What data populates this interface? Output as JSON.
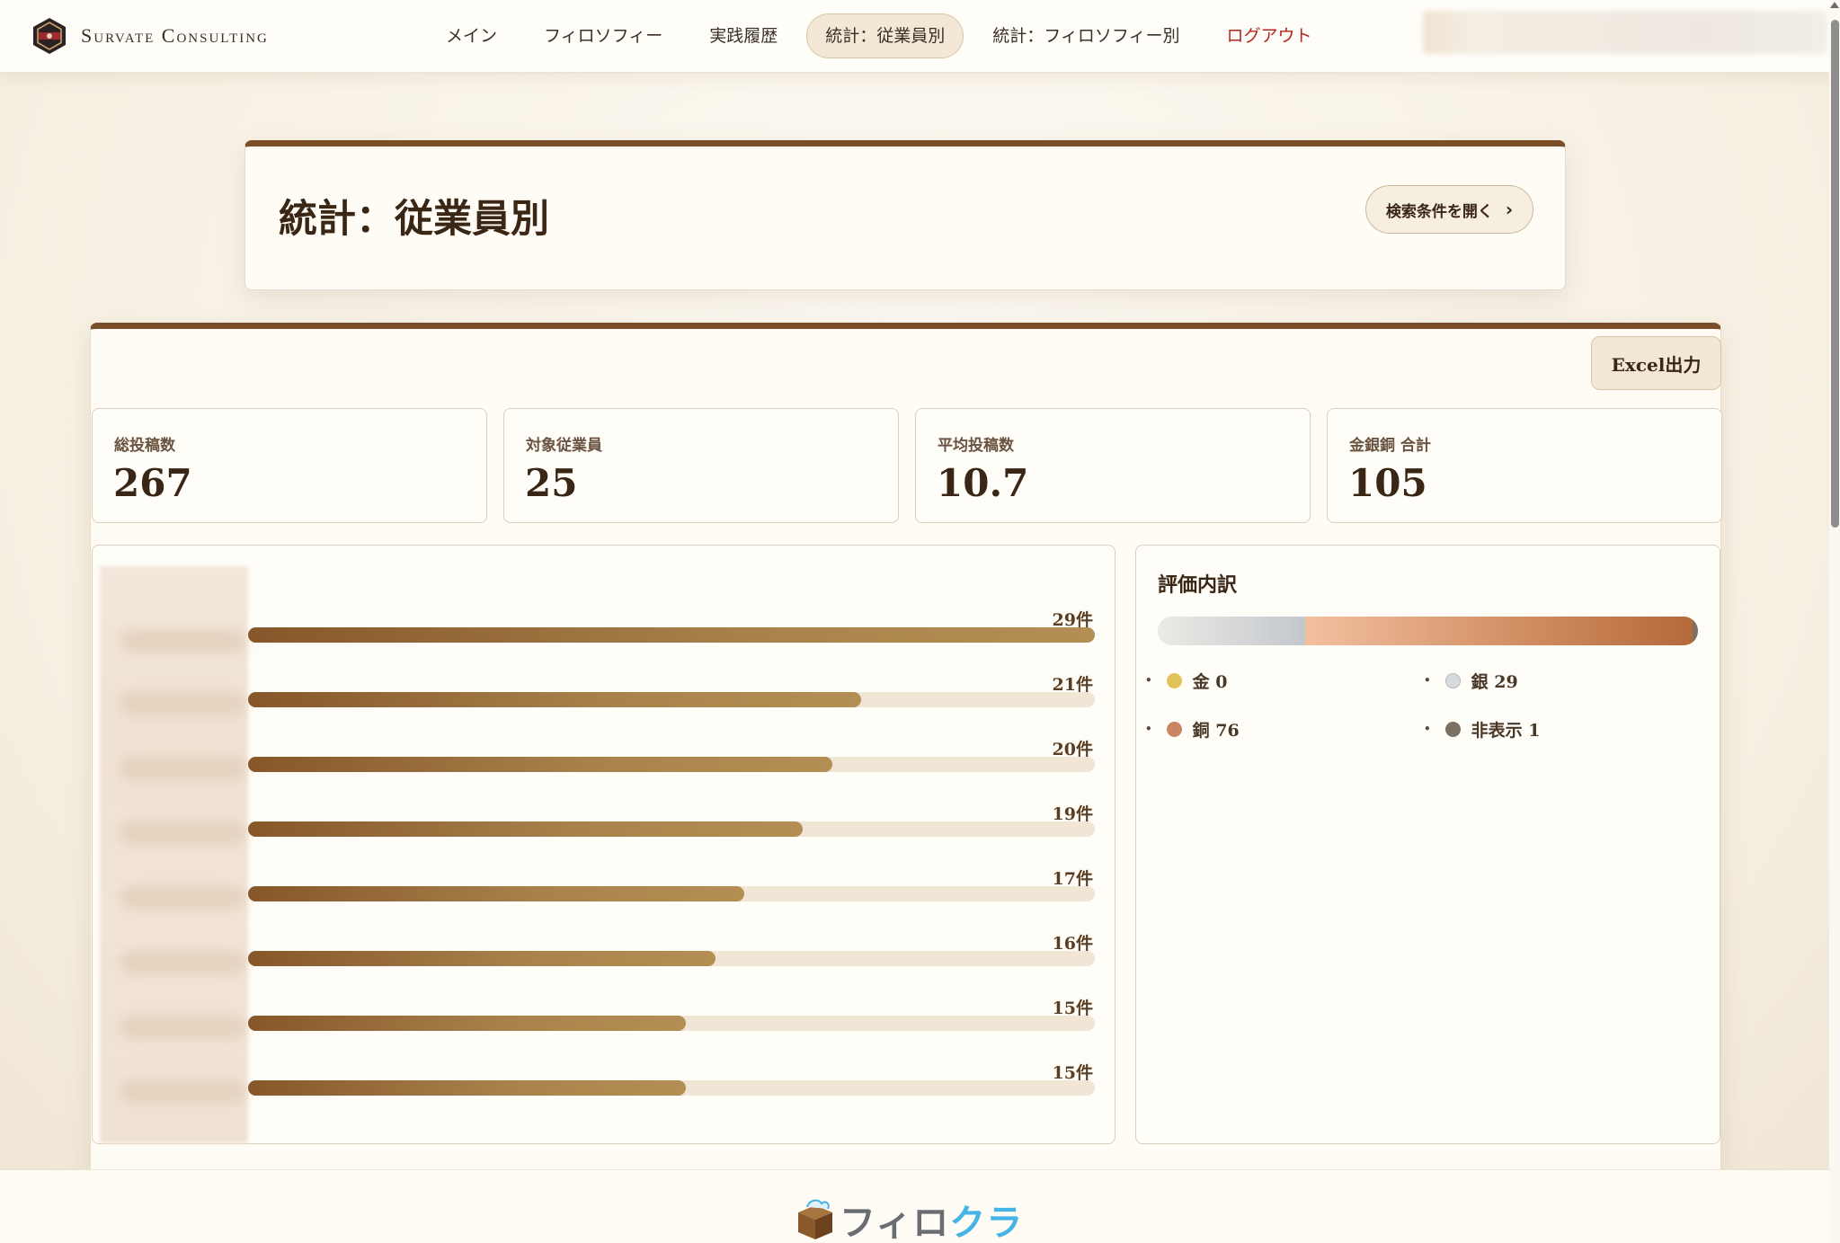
{
  "header": {
    "brand": "Survate Consulting",
    "nav": [
      {
        "label": "メイン",
        "active": false
      },
      {
        "label": "フィロソフィー",
        "active": false
      },
      {
        "label": "実践履歴",
        "active": false
      },
      {
        "label": "統計：従業員別",
        "active": true
      },
      {
        "label": "統計：フィロソフィー別",
        "active": false
      }
    ],
    "logout_label": "ログアウト"
  },
  "title_panel": {
    "title": "統計：従業員別",
    "search_toggle_label": "検索条件を開く"
  },
  "stats": {
    "excel_label": "Excel出力",
    "kpis": [
      {
        "label": "総投稿数",
        "value": "267"
      },
      {
        "label": "対象従業員",
        "value": "25"
      },
      {
        "label": "平均投稿数",
        "value": "10.7"
      },
      {
        "label": "金銀銅 合計",
        "value": "105"
      }
    ]
  },
  "chart_data": [
    {
      "type": "bar",
      "orientation": "horizontal",
      "title": "",
      "categories": [
        "",
        "",
        "",
        "",
        "",
        "",
        "",
        ""
      ],
      "values": [
        29,
        21,
        20,
        19,
        17,
        16,
        15,
        15
      ],
      "value_labels": [
        "29件",
        "21件",
        "20件",
        "19件",
        "17件",
        "16件",
        "15件",
        "15件"
      ],
      "xlim": [
        0,
        29
      ]
    },
    {
      "type": "bar",
      "orientation": "stacked-horizontal",
      "title": "評価内訳",
      "series": [
        {
          "name": "金",
          "value": 0,
          "color": "#e3c25a"
        },
        {
          "name": "銀",
          "value": 29,
          "color": "#c9cdd3"
        },
        {
          "name": "銅",
          "value": 76,
          "color": "#c98662"
        },
        {
          "name": "非表示",
          "value": 1,
          "color": "#7c7062"
        }
      ],
      "legend_labels": [
        "金 0",
        "銀 29",
        "銅 76",
        "非表示 1"
      ]
    }
  ],
  "footer": {
    "brand_part1": "フィロ",
    "brand_part2": "クラ"
  }
}
